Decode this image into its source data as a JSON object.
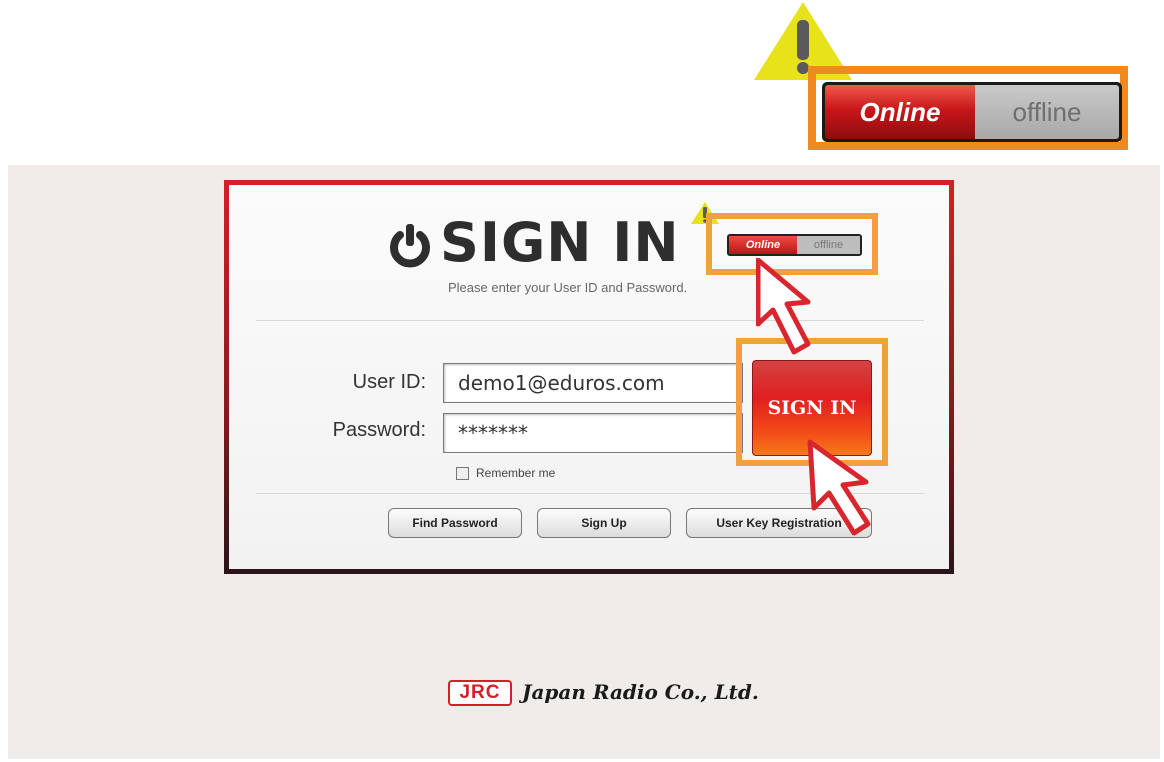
{
  "toggle": {
    "online_label": "Online",
    "offline_label": "offline"
  },
  "signin": {
    "title": "SIGN IN",
    "subtitle": "Please enter your User ID and Password.",
    "user_id_label": "User ID:",
    "user_id_value": "demo1@eduros.com",
    "password_label": "Password:",
    "password_value": "*******",
    "remember_label": "Remember me",
    "signin_button": "SIGN IN"
  },
  "buttons": {
    "find_password": "Find Password",
    "sign_up": "Sign Up",
    "user_key_registration": "User Key Registration"
  },
  "footer": {
    "logo": "JRC",
    "company": "Japan Radio Co., Ltd."
  },
  "colors": {
    "accent_red": "#d31f26",
    "highlight_orange": "#f08a1e",
    "warning_yellow": "#e8e21a"
  },
  "icons": [
    "warning-icon",
    "power-icon",
    "cursor-arrow-icon",
    "checkbox-icon"
  ]
}
